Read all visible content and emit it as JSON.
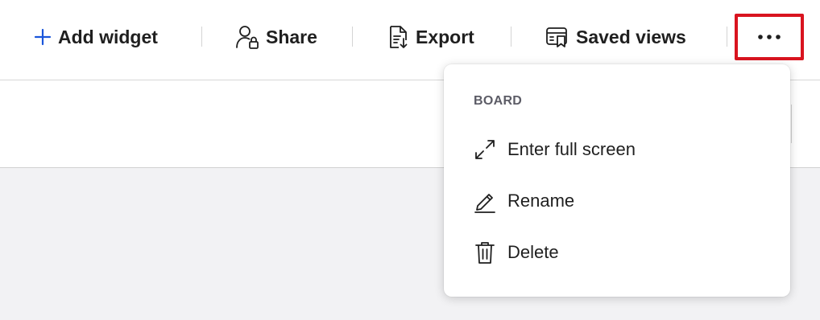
{
  "toolbar": {
    "add_widget": "Add widget",
    "share": "Share",
    "export": "Export",
    "saved_views": "Saved views",
    "more_icon": "more-horizontal-icon"
  },
  "menu": {
    "section_label": "BOARD",
    "items": [
      {
        "label": "Enter full screen",
        "icon": "expand-icon"
      },
      {
        "label": "Rename",
        "icon": "pencil-icon"
      },
      {
        "label": "Delete",
        "icon": "trash-icon"
      }
    ]
  },
  "colors": {
    "accent": "#1a56db",
    "highlight_border": "#d9141f",
    "canvas_background": "#f2f2f4",
    "menu_heading": "#5c5c66"
  }
}
